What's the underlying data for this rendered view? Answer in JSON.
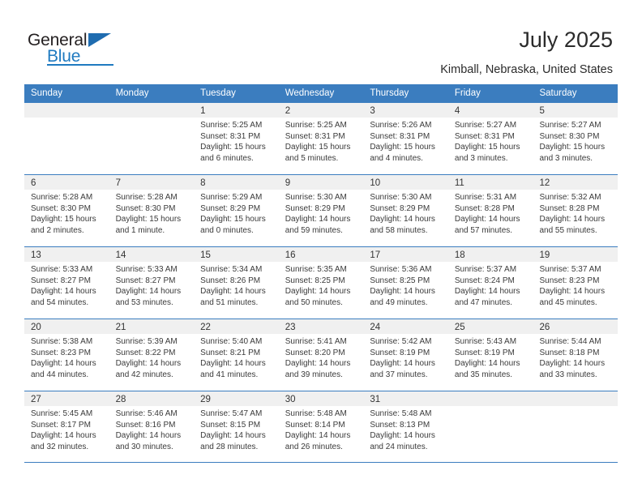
{
  "brand": {
    "name_part1": "General",
    "name_part2": "Blue"
  },
  "header": {
    "title": "July 2025",
    "location": "Kimball, Nebraska, United States"
  },
  "theme": {
    "header_blue": "#3b7dbf",
    "brand_blue": "#1f7ac0",
    "day_head_gray": "#f0f0f0",
    "text": "#333333"
  },
  "weekdays": [
    "Sunday",
    "Monday",
    "Tuesday",
    "Wednesday",
    "Thursday",
    "Friday",
    "Saturday"
  ],
  "weeks": [
    [
      {
        "day": "",
        "sunrise": "",
        "sunset": "",
        "daylight": "",
        "empty": true
      },
      {
        "day": "",
        "sunrise": "",
        "sunset": "",
        "daylight": "",
        "empty": true
      },
      {
        "day": "1",
        "sunrise": "Sunrise: 5:25 AM",
        "sunset": "Sunset: 8:31 PM",
        "daylight": "Daylight: 15 hours and 6 minutes."
      },
      {
        "day": "2",
        "sunrise": "Sunrise: 5:25 AM",
        "sunset": "Sunset: 8:31 PM",
        "daylight": "Daylight: 15 hours and 5 minutes."
      },
      {
        "day": "3",
        "sunrise": "Sunrise: 5:26 AM",
        "sunset": "Sunset: 8:31 PM",
        "daylight": "Daylight: 15 hours and 4 minutes."
      },
      {
        "day": "4",
        "sunrise": "Sunrise: 5:27 AM",
        "sunset": "Sunset: 8:31 PM",
        "daylight": "Daylight: 15 hours and 3 minutes."
      },
      {
        "day": "5",
        "sunrise": "Sunrise: 5:27 AM",
        "sunset": "Sunset: 8:30 PM",
        "daylight": "Daylight: 15 hours and 3 minutes."
      }
    ],
    [
      {
        "day": "6",
        "sunrise": "Sunrise: 5:28 AM",
        "sunset": "Sunset: 8:30 PM",
        "daylight": "Daylight: 15 hours and 2 minutes."
      },
      {
        "day": "7",
        "sunrise": "Sunrise: 5:28 AM",
        "sunset": "Sunset: 8:30 PM",
        "daylight": "Daylight: 15 hours and 1 minute."
      },
      {
        "day": "8",
        "sunrise": "Sunrise: 5:29 AM",
        "sunset": "Sunset: 8:29 PM",
        "daylight": "Daylight: 15 hours and 0 minutes."
      },
      {
        "day": "9",
        "sunrise": "Sunrise: 5:30 AM",
        "sunset": "Sunset: 8:29 PM",
        "daylight": "Daylight: 14 hours and 59 minutes."
      },
      {
        "day": "10",
        "sunrise": "Sunrise: 5:30 AM",
        "sunset": "Sunset: 8:29 PM",
        "daylight": "Daylight: 14 hours and 58 minutes."
      },
      {
        "day": "11",
        "sunrise": "Sunrise: 5:31 AM",
        "sunset": "Sunset: 8:28 PM",
        "daylight": "Daylight: 14 hours and 57 minutes."
      },
      {
        "day": "12",
        "sunrise": "Sunrise: 5:32 AM",
        "sunset": "Sunset: 8:28 PM",
        "daylight": "Daylight: 14 hours and 55 minutes."
      }
    ],
    [
      {
        "day": "13",
        "sunrise": "Sunrise: 5:33 AM",
        "sunset": "Sunset: 8:27 PM",
        "daylight": "Daylight: 14 hours and 54 minutes."
      },
      {
        "day": "14",
        "sunrise": "Sunrise: 5:33 AM",
        "sunset": "Sunset: 8:27 PM",
        "daylight": "Daylight: 14 hours and 53 minutes."
      },
      {
        "day": "15",
        "sunrise": "Sunrise: 5:34 AM",
        "sunset": "Sunset: 8:26 PM",
        "daylight": "Daylight: 14 hours and 51 minutes."
      },
      {
        "day": "16",
        "sunrise": "Sunrise: 5:35 AM",
        "sunset": "Sunset: 8:25 PM",
        "daylight": "Daylight: 14 hours and 50 minutes."
      },
      {
        "day": "17",
        "sunrise": "Sunrise: 5:36 AM",
        "sunset": "Sunset: 8:25 PM",
        "daylight": "Daylight: 14 hours and 49 minutes."
      },
      {
        "day": "18",
        "sunrise": "Sunrise: 5:37 AM",
        "sunset": "Sunset: 8:24 PM",
        "daylight": "Daylight: 14 hours and 47 minutes."
      },
      {
        "day": "19",
        "sunrise": "Sunrise: 5:37 AM",
        "sunset": "Sunset: 8:23 PM",
        "daylight": "Daylight: 14 hours and 45 minutes."
      }
    ],
    [
      {
        "day": "20",
        "sunrise": "Sunrise: 5:38 AM",
        "sunset": "Sunset: 8:23 PM",
        "daylight": "Daylight: 14 hours and 44 minutes."
      },
      {
        "day": "21",
        "sunrise": "Sunrise: 5:39 AM",
        "sunset": "Sunset: 8:22 PM",
        "daylight": "Daylight: 14 hours and 42 minutes."
      },
      {
        "day": "22",
        "sunrise": "Sunrise: 5:40 AM",
        "sunset": "Sunset: 8:21 PM",
        "daylight": "Daylight: 14 hours and 41 minutes."
      },
      {
        "day": "23",
        "sunrise": "Sunrise: 5:41 AM",
        "sunset": "Sunset: 8:20 PM",
        "daylight": "Daylight: 14 hours and 39 minutes."
      },
      {
        "day": "24",
        "sunrise": "Sunrise: 5:42 AM",
        "sunset": "Sunset: 8:19 PM",
        "daylight": "Daylight: 14 hours and 37 minutes."
      },
      {
        "day": "25",
        "sunrise": "Sunrise: 5:43 AM",
        "sunset": "Sunset: 8:19 PM",
        "daylight": "Daylight: 14 hours and 35 minutes."
      },
      {
        "day": "26",
        "sunrise": "Sunrise: 5:44 AM",
        "sunset": "Sunset: 8:18 PM",
        "daylight": "Daylight: 14 hours and 33 minutes."
      }
    ],
    [
      {
        "day": "27",
        "sunrise": "Sunrise: 5:45 AM",
        "sunset": "Sunset: 8:17 PM",
        "daylight": "Daylight: 14 hours and 32 minutes."
      },
      {
        "day": "28",
        "sunrise": "Sunrise: 5:46 AM",
        "sunset": "Sunset: 8:16 PM",
        "daylight": "Daylight: 14 hours and 30 minutes."
      },
      {
        "day": "29",
        "sunrise": "Sunrise: 5:47 AM",
        "sunset": "Sunset: 8:15 PM",
        "daylight": "Daylight: 14 hours and 28 minutes."
      },
      {
        "day": "30",
        "sunrise": "Sunrise: 5:48 AM",
        "sunset": "Sunset: 8:14 PM",
        "daylight": "Daylight: 14 hours and 26 minutes."
      },
      {
        "day": "31",
        "sunrise": "Sunrise: 5:48 AM",
        "sunset": "Sunset: 8:13 PM",
        "daylight": "Daylight: 14 hours and 24 minutes."
      },
      {
        "day": "",
        "sunrise": "",
        "sunset": "",
        "daylight": "",
        "empty": true
      },
      {
        "day": "",
        "sunrise": "",
        "sunset": "",
        "daylight": "",
        "empty": true
      }
    ]
  ]
}
